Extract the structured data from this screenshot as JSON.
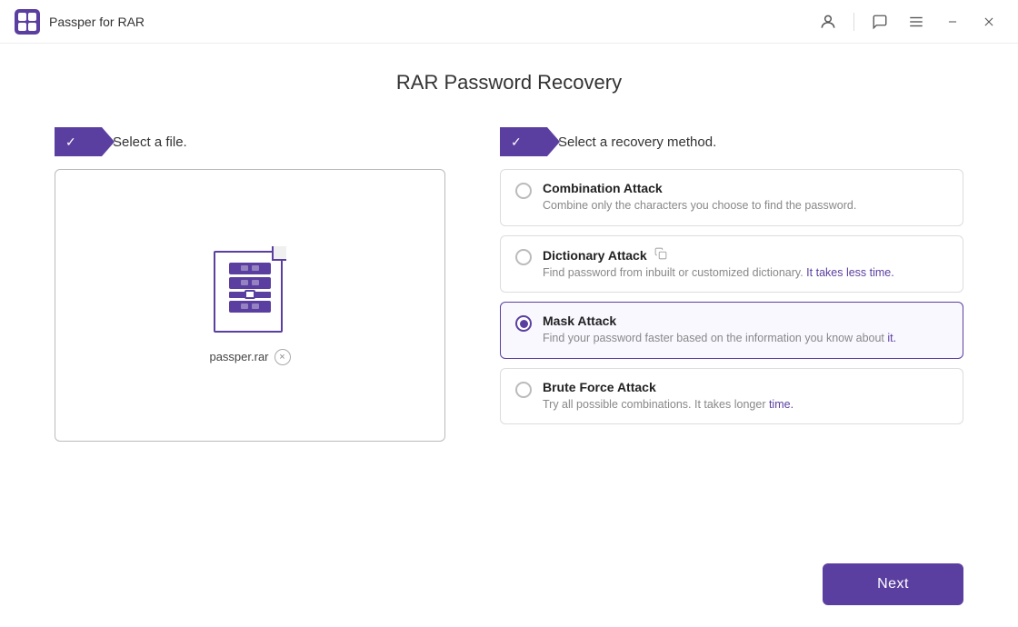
{
  "app": {
    "title": "Passper for RAR",
    "logo_alt": "Passper logo"
  },
  "titlebar": {
    "icons": [
      "account-icon",
      "comment-icon",
      "menu-icon",
      "minimize-icon",
      "close-icon"
    ]
  },
  "page": {
    "title": "RAR Password Recovery"
  },
  "steps": {
    "step1": {
      "label": "Select a file."
    },
    "step2": {
      "label": "Select a recovery method."
    }
  },
  "file": {
    "name": "passper.rar",
    "remove_label": "×"
  },
  "methods": [
    {
      "id": "combination",
      "title": "Combination Attack",
      "desc": "Combine only the characters you choose to find the password.",
      "selected": false,
      "has_copy_icon": false
    },
    {
      "id": "dictionary",
      "title": "Dictionary Attack",
      "desc_plain": "Find password from inbuilt or customized dictionary.",
      "desc_accent": " It takes less time.",
      "selected": false,
      "has_copy_icon": true
    },
    {
      "id": "mask",
      "title": "Mask Attack",
      "desc_plain": "Find your password faster based on the information you know about",
      "desc_accent": " it.",
      "selected": true,
      "has_copy_icon": false
    },
    {
      "id": "brute",
      "title": "Brute Force Attack",
      "desc_plain": "Try all possible combinations. It takes longer",
      "desc_accent": " time.",
      "selected": false,
      "has_copy_icon": false
    }
  ],
  "footer": {
    "next_label": "Next"
  }
}
